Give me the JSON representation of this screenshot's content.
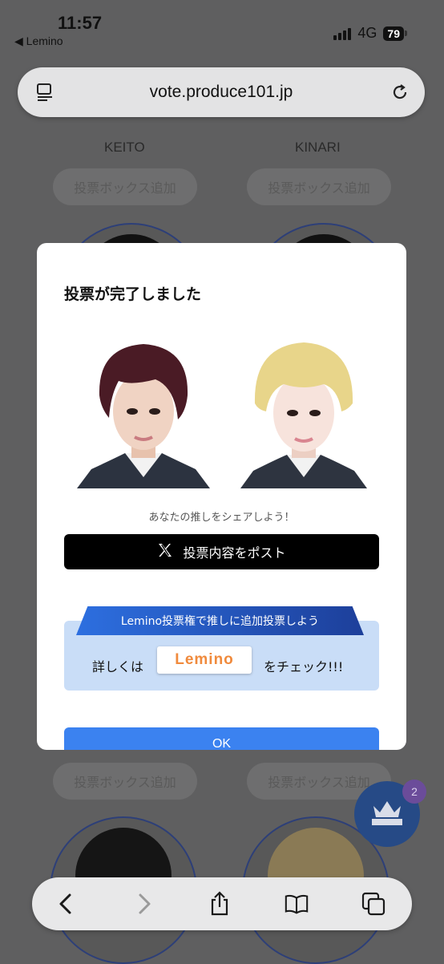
{
  "status": {
    "time": "11:57",
    "back_app": "◀ Lemino",
    "network": "4G",
    "battery": "79"
  },
  "browser": {
    "url": "vote.produce101.jp"
  },
  "background": {
    "names": [
      "KEITO",
      "KINARI"
    ],
    "add_box_label": "投票ボックス追加"
  },
  "modal": {
    "title": "投票が完了しました",
    "share_caption": "あなたの推しをシェアしよう！",
    "post_button": "投票内容をポスト",
    "promo_banner": "Lemino投票権で推しに追加投票しよう",
    "promo_prefix": "詳しくは",
    "promo_logo": "Lemino",
    "promo_suffix": "をチェック!!!",
    "ok_button": "OK"
  },
  "floating": {
    "badge_count": "2"
  },
  "icons": {
    "reader": "reader-icon",
    "reload": "reload-icon",
    "x_logo": "x-logo-icon",
    "crown": "crown-icon",
    "back": "chevron-left-icon",
    "forward": "chevron-right-icon",
    "share": "share-icon",
    "bookmarks": "book-icon",
    "tabs": "tabs-icon"
  },
  "colors": {
    "overlay": "#5f5f60",
    "primary_blue": "#3b82f0",
    "promo_bg": "#c9ddf7",
    "crown_button": "#264a86"
  }
}
